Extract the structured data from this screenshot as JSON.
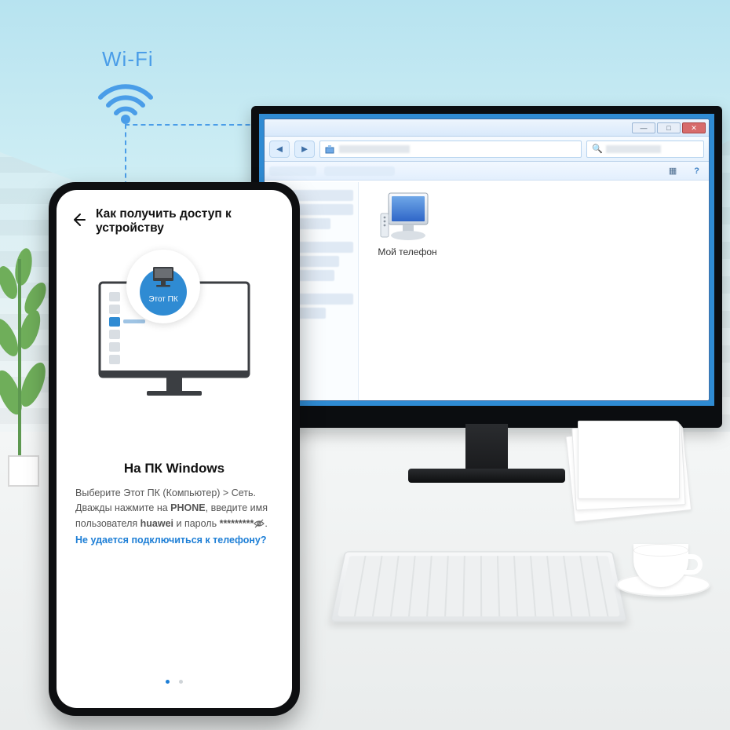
{
  "wifi": {
    "label": "Wi-Fi"
  },
  "windows_explorer": {
    "title_buttons": {
      "min": "—",
      "max": "□",
      "close": "✕"
    },
    "nav": {
      "back": "◄",
      "forward": "►",
      "address_placeholder": "",
      "search_placeholder": ""
    },
    "toolbar": {
      "organize": "",
      "properties": "",
      "view_icons": "▦",
      "help": "?"
    },
    "device": {
      "label": "Мой телефон"
    }
  },
  "phone": {
    "header_title": "Как получить доступ к устройству",
    "illustration_tooltip": "Этот ПК",
    "section_title": "На ПК Windows",
    "instructions": {
      "part1": "Выберите Этот ПК (Компьютер) > Сеть. Дважды нажмите на ",
      "bold1": "PHONE",
      "part2": ", введите имя пользователя ",
      "bold2": "huawei",
      "part3": " и пароль ",
      "password_mask": "*********",
      "part4": ". ",
      "link": "Не удается подключиться к телефону?"
    },
    "page_indicator": {
      "current": 1,
      "total": 2
    }
  }
}
